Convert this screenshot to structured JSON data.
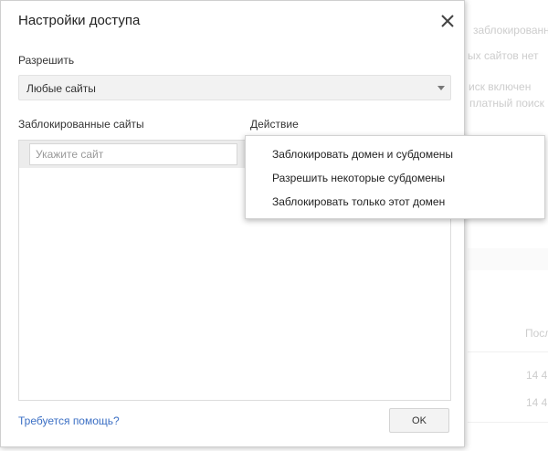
{
  "background": {
    "texts": [
      "заблокированных",
      "ых сайтов нет",
      "иск включен",
      "платный поиск",
      "Посл",
      "14 4",
      "14 4"
    ]
  },
  "dialog": {
    "title": "Настройки доступа",
    "close_icon": "close-icon",
    "permit_label": "Разрешить",
    "permit_select_value": "Любые сайты",
    "blocked_sites_header": "Заблокированные сайты",
    "action_header": "Действие",
    "site_input_placeholder": "Укажите сайт",
    "site_input_value": "",
    "help_link": "Требуется помощь?",
    "ok_button": "OK"
  },
  "action_menu": {
    "items": [
      "Заблокировать домен и субдомены",
      "Разрешить некоторые субдомены",
      "Заблокировать только этот домен"
    ]
  },
  "colors": {
    "link": "#3b6fc4",
    "select_bg": "#f2f2f2",
    "header_bg": "#ececec"
  }
}
